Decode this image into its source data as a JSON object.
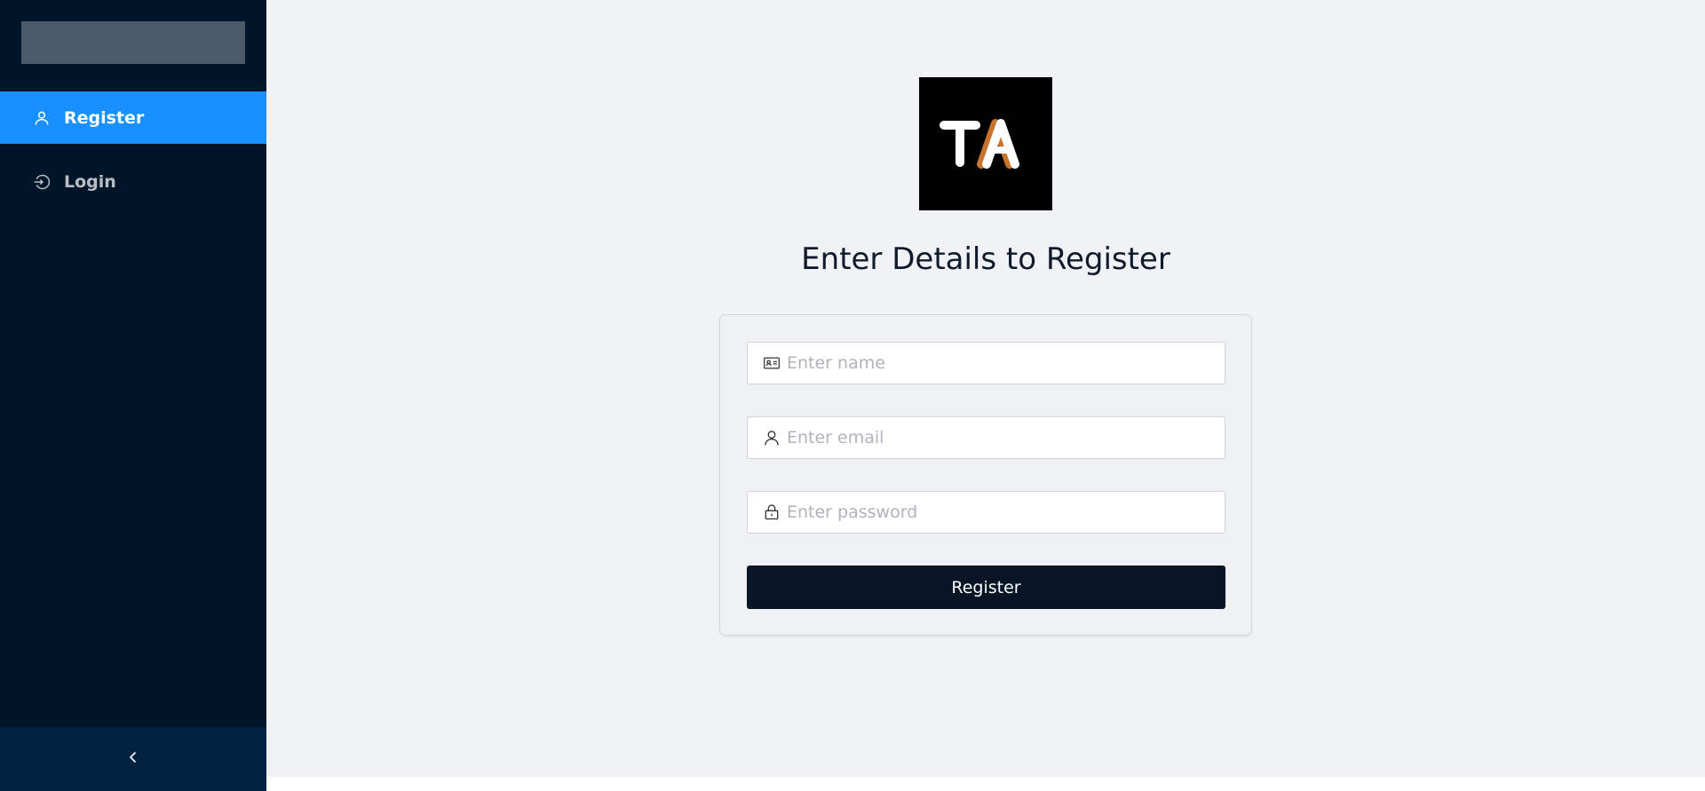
{
  "sidebar": {
    "items": [
      {
        "label": "Register",
        "icon": "user-icon",
        "active": true
      },
      {
        "label": "Login",
        "icon": "login-icon",
        "active": false
      }
    ],
    "collapse_icon": "chevron-left-icon"
  },
  "main": {
    "logo": {
      "letters": "TA",
      "background": "#000000",
      "accent": "#c8742c"
    },
    "title": "Enter Details to Register",
    "form": {
      "name_placeholder": "Enter name",
      "email_placeholder": "Enter email",
      "password_placeholder": "Enter password",
      "submit_label": "Register"
    }
  },
  "colors": {
    "sidebar_bg": "#001529",
    "active_item": "#1890ff",
    "button_bg": "#071526",
    "page_bg": "#f0f2f5"
  }
}
